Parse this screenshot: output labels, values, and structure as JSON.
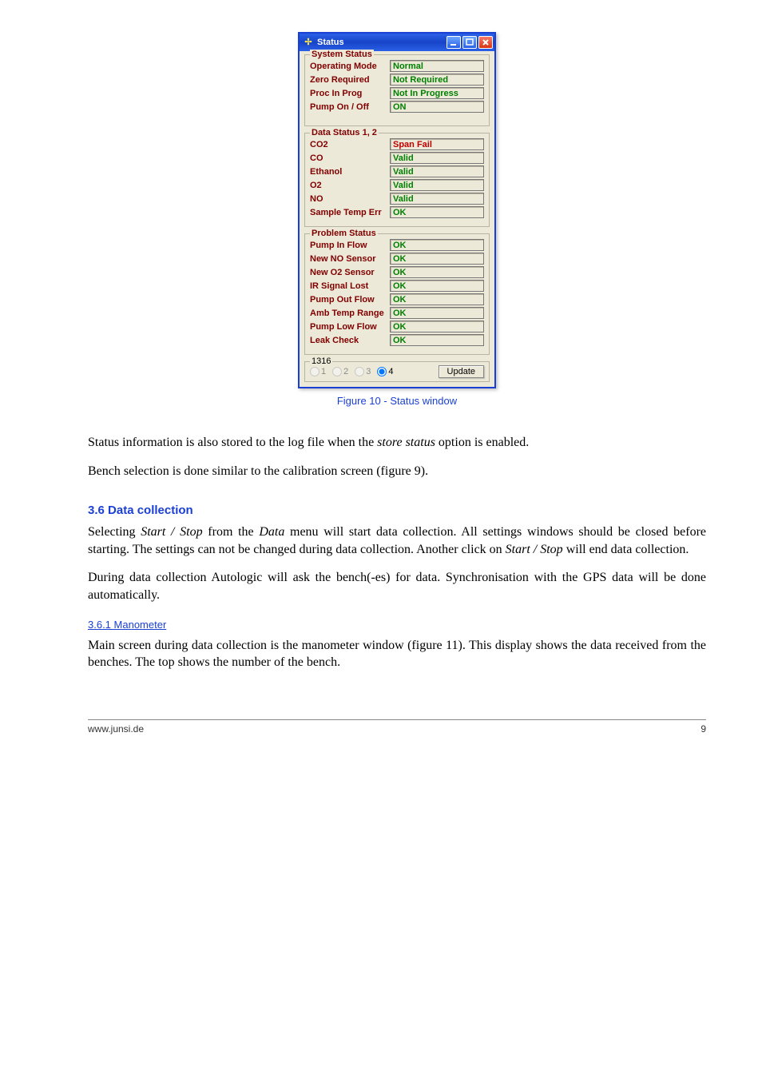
{
  "window": {
    "title": "Status",
    "groups": {
      "system": {
        "legend": "System Status",
        "rows": [
          {
            "label": "Operating Mode",
            "value": "Normal",
            "cls": "v-green"
          },
          {
            "label": "Zero Required",
            "value": "Not Required",
            "cls": "v-green"
          },
          {
            "label": "Proc In Prog",
            "value": "Not In Progress",
            "cls": "v-green"
          },
          {
            "label": "Pump On / Off",
            "value": "ON",
            "cls": "v-green"
          }
        ]
      },
      "data": {
        "legend": "Data Status 1, 2",
        "rows": [
          {
            "label": "CO2",
            "value": "Span Fail",
            "cls": "v-red"
          },
          {
            "label": "CO",
            "value": "Valid",
            "cls": "v-green"
          },
          {
            "label": "Ethanol",
            "value": "Valid",
            "cls": "v-green"
          },
          {
            "label": "O2",
            "value": "Valid",
            "cls": "v-green"
          },
          {
            "label": "NO",
            "value": "Valid",
            "cls": "v-green"
          },
          {
            "label": "Sample Temp Err",
            "value": "OK",
            "cls": "v-green"
          }
        ]
      },
      "problem": {
        "legend": "Problem Status",
        "rows": [
          {
            "label": "Pump In Flow",
            "value": "OK",
            "cls": "v-green"
          },
          {
            "label": "New NO Sensor",
            "value": "OK",
            "cls": "v-green"
          },
          {
            "label": "New O2 Sensor",
            "value": "OK",
            "cls": "v-green"
          },
          {
            "label": "IR Signal Lost",
            "value": "OK",
            "cls": "v-green"
          },
          {
            "label": "Pump Out Flow",
            "value": "OK",
            "cls": "v-green"
          },
          {
            "label": "Amb Temp Range",
            "value": "OK",
            "cls": "v-green"
          },
          {
            "label": "Pump Low Flow",
            "value": "OK",
            "cls": "v-green"
          },
          {
            "label": "Leak Check",
            "value": "OK",
            "cls": "v-green"
          }
        ]
      },
      "selector": {
        "legend": "1316",
        "options": [
          "1",
          "2",
          "3",
          "4"
        ],
        "selected": "4",
        "button": "Update"
      }
    }
  },
  "caption": "Figure 10 - Status window",
  "body": {
    "p1": "Status information is also stored to the log file when the ",
    "p1_em": "store status",
    "p1_tail": " option is enabled.",
    "p2": "Bench selection is done similar to the calibration screen (figure 9).",
    "h3": "3.6 Data collection",
    "p3a": "Selecting ",
    "p3a_em": "Start / Stop",
    "p3a_b": " from the ",
    "p3a_em2": "Data",
    "p3a_tail": " menu will start data collection. All settings windows should be closed before starting. The settings can not be changed during data collection. Another click on ",
    "p3b_em": "Start / Stop",
    "p3b_tail": " will end data collection.",
    "p4": "During data collection Autologic will ask the bench(-es) for data. Synchronisation with the GPS data will be done automatically.",
    "h4": "3.6.1 Manometer",
    "p5": "Main screen during data collection is the manometer window (figure 11). This display shows the data received from the benches. The top shows the number of the bench."
  },
  "footer": {
    "left": "www.junsi.de",
    "right": "9"
  }
}
